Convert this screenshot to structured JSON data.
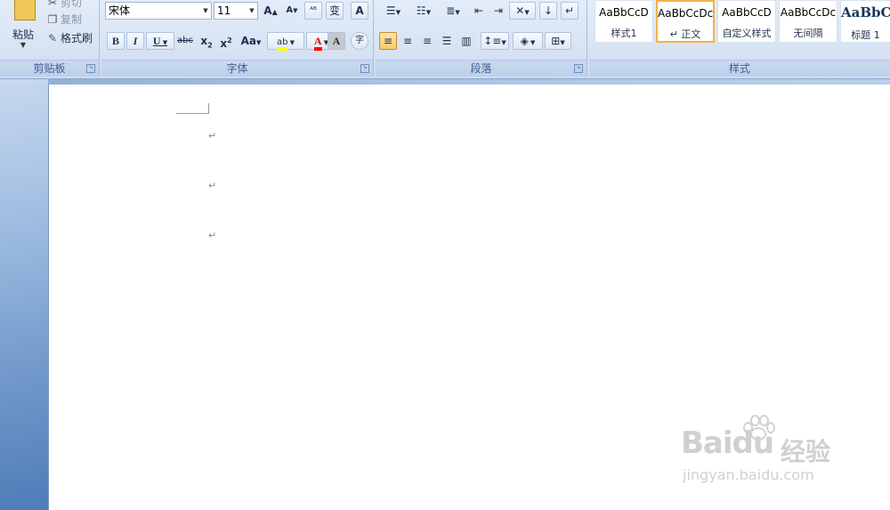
{
  "clipboard": {
    "group_label": "剪贴板",
    "paste_label": "粘贴",
    "cut_label": "剪切",
    "copy_label": "复制",
    "format_painter_label": "格式刷"
  },
  "font": {
    "group_label": "字体",
    "font_name": "宋体",
    "font_size": "11",
    "grow_label": "A",
    "shrink_label": "A",
    "clear_format_label": "ᴬᴮ",
    "phonetic_label": "变",
    "border_char_label": "A",
    "bold_label": "B",
    "italic_label": "I",
    "underline_label": "U",
    "strike_label": "abc",
    "subscript_label": "x",
    "superscript_label": "x",
    "change_case_label": "Aa",
    "highlight_label": "ab",
    "font_color_label": "A",
    "char_shading_label": "A",
    "enclose_char_label": "字"
  },
  "paragraph": {
    "group_label": "段落"
  },
  "styles": {
    "group_label": "样式",
    "items": [
      {
        "sample": "AaBbCcD",
        "name": "样式1"
      },
      {
        "sample": "AaBbCcDc",
        "name": "↵ 正文"
      },
      {
        "sample": "AaBbCcD",
        "name": "自定义样式"
      },
      {
        "sample": "AaBbCcDc",
        "name": "无间隔"
      },
      {
        "sample": "AaBbC",
        "name": "标题 1"
      }
    ]
  },
  "document": {
    "paragraph_marks": [
      "↵",
      "↵",
      "↵"
    ]
  },
  "watermark": {
    "logo_text": "Baidu",
    "cn_text": "经验",
    "url": "jingyan.baidu.com"
  },
  "colors": {
    "highlight": "#ffff00",
    "font_color": "#ff0000",
    "selected_style_border": "#f2b248"
  }
}
